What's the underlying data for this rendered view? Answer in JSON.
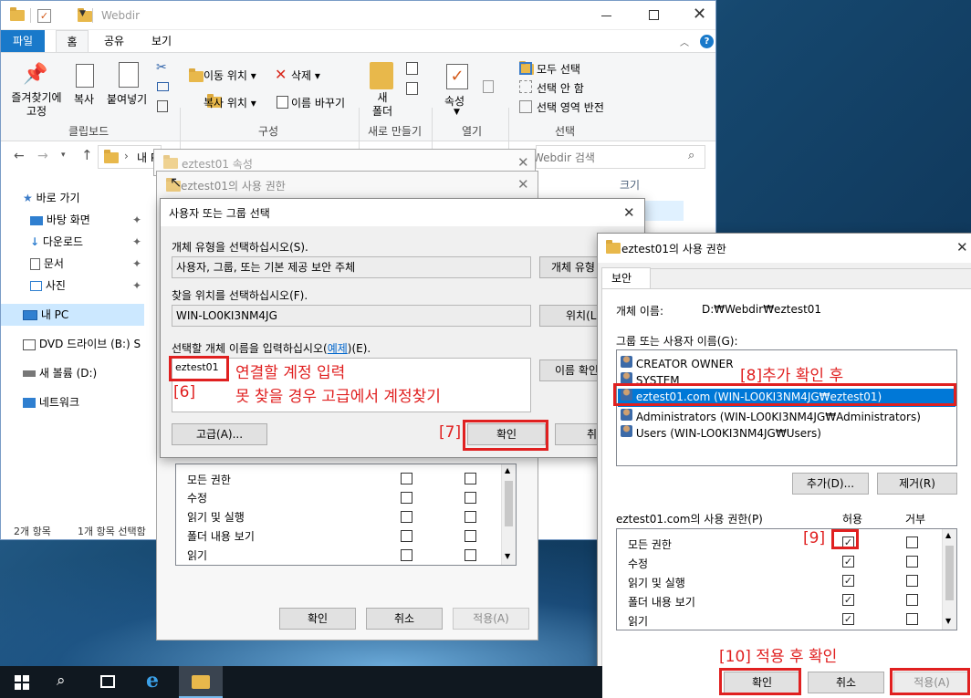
{
  "explorer": {
    "title": "Webdir",
    "tabs": [
      "파일",
      "홈",
      "공유",
      "보기"
    ],
    "ribbon": {
      "clipboard": {
        "pin": "즐겨찾기에\n고정",
        "copy": "복사",
        "paste": "붙여넣기",
        "label": "클립보드"
      },
      "organize": {
        "move": "이동 위치",
        "delete": "삭제",
        "copyto": "복사 위치",
        "rename": "이름 바꾸기",
        "label": "구성"
      },
      "new": {
        "folder": "새\n폴더",
        "label": "새로 만들기"
      },
      "open": {
        "props": "속성",
        "label": "열기"
      },
      "select": {
        "all": "모두 선택",
        "none": "선택 안 함",
        "invert": "선택 영역 반전",
        "label": "선택"
      }
    },
    "address": "내 P",
    "search_placeholder": "Webdir 검색",
    "column_size": "크기",
    "nav": [
      {
        "label": "바로 가기",
        "icon": "star-icon"
      },
      {
        "label": "바탕 화면",
        "icon": "desktop-icon"
      },
      {
        "label": "다운로드",
        "icon": "download-icon"
      },
      {
        "label": "문서",
        "icon": "document-icon"
      },
      {
        "label": "사진",
        "icon": "picture-icon"
      },
      {
        "label": "내 PC",
        "icon": "computer-icon"
      },
      {
        "label": "DVD 드라이브 (B:) S",
        "icon": "dvd-icon"
      },
      {
        "label": "새 볼륨 (D:)",
        "icon": "drive-icon"
      },
      {
        "label": "네트워크",
        "icon": "network-icon"
      }
    ],
    "status_count": "2개 항목",
    "status_selected": "1개 항목 선택함"
  },
  "props_dialog": {
    "title": "eztest01 속성"
  },
  "perm_back": {
    "title": "eztest01의 사용 권한",
    "perms": [
      "모든 권한",
      "수정",
      "읽기 및 실행",
      "폴더 내용 보기",
      "읽기"
    ],
    "ok": "확인",
    "cancel": "취소",
    "apply": "적용(A)"
  },
  "select_dialog": {
    "title": "사용자 또는 그룹 선택",
    "objtype_label": "개체 유형을 선택하십시오(S).",
    "objtype_value": "사용자, 그룹, 또는 기본 제공 보안 주체",
    "objtype_btn": "개체 유형",
    "location_label": "찾을 위치를 선택하십시오(F).",
    "location_value": "WIN-LO0KI3NM4JG",
    "location_btn": "위치(L",
    "names_label_a": "선택할 개체 이름을 입력하십시오(",
    "names_label_link": "예제",
    "names_label_b": ")(E).",
    "names_value": "eztest01",
    "checknames_btn": "이름 확인",
    "advanced_btn": "고급(A)...",
    "ok": "확인",
    "cancel": "취"
  },
  "perm_front": {
    "title": "eztest01의 사용 권한",
    "tab": "보안",
    "objname_label": "개체 이름:",
    "objname_value": "D:₩Webdir₩eztest01",
    "group_label": "그룹 또는 사용자 이름(G):",
    "users": [
      "CREATOR OWNER",
      "SYSTEM",
      "eztest01.com (WIN-LO0KI3NM4JG₩eztest01)",
      "Administrators (WIN-LO0KI3NM4JG₩Administrators)",
      "Users (WIN-LO0KI3NM4JG₩Users)"
    ],
    "add": "추가(D)...",
    "remove": "제거(R)",
    "perm_label": "eztest01.com의 사용 권한(P)",
    "allow": "허용",
    "deny": "거부",
    "perms": [
      "모든 권한",
      "수정",
      "읽기 및 실행",
      "폴더 내용 보기",
      "읽기"
    ],
    "allow_checked": [
      true,
      true,
      true,
      true,
      true
    ],
    "ok": "확인",
    "cancel": "취소",
    "apply": "적용(A)"
  },
  "annotations": {
    "a6_line1": "연결할 계정 입력",
    "a6_tag": "[6]",
    "a6_line2": "못 찾을 경우 고급에서 계정찾기",
    "a7": "[7]",
    "a8": "[8]추가 확인 후",
    "a9": "[9]",
    "a10": "[10] 적용 후 확인"
  },
  "colors": {
    "accent": "#1979ca",
    "selection": "#0078d7",
    "annotation": "#e02020"
  }
}
